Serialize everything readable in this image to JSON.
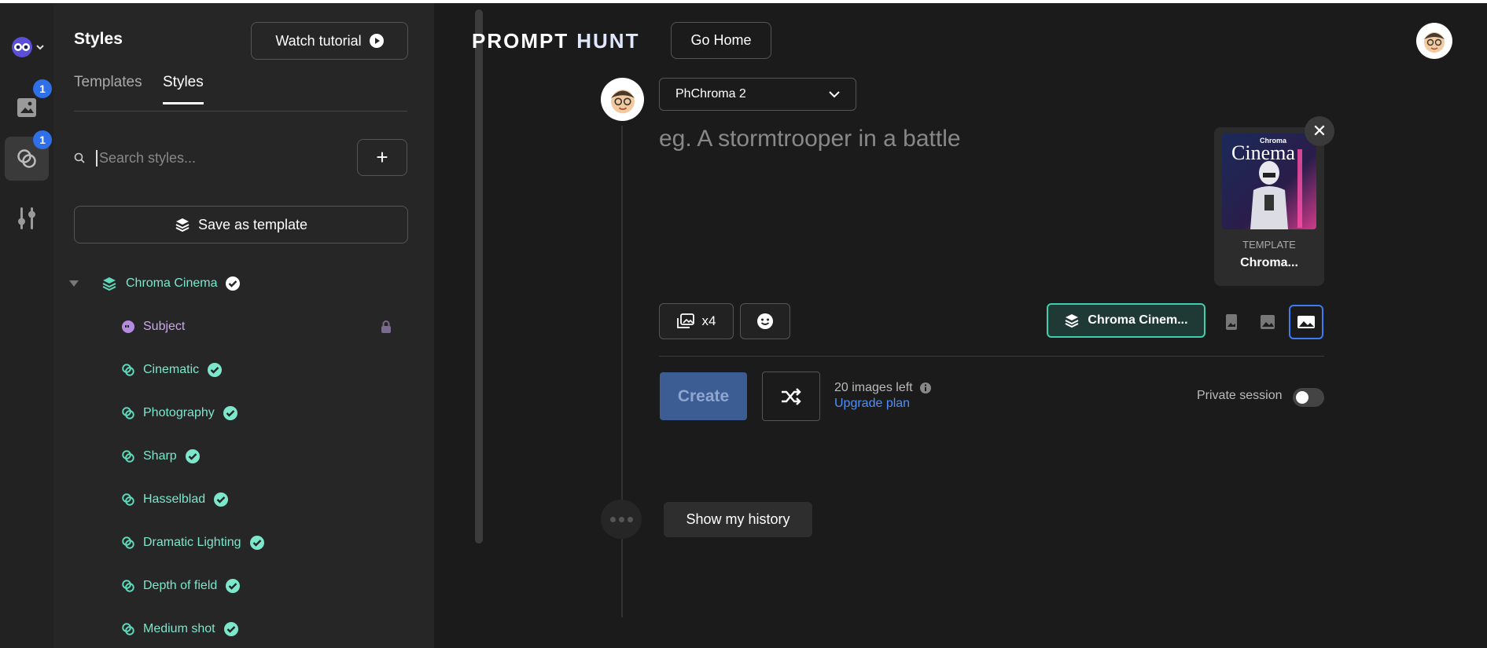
{
  "sidebar": {
    "title": "Styles",
    "watch_tutorial_label": "Watch tutorial",
    "tabs": [
      {
        "label": "Templates"
      },
      {
        "label": "Styles"
      }
    ],
    "search_placeholder": "Search styles...",
    "save_template_label": "Save as template",
    "tree": {
      "root": "Chroma Cinema",
      "items": [
        {
          "label": "Subject",
          "locked": true
        },
        {
          "label": "Cinematic"
        },
        {
          "label": "Photography"
        },
        {
          "label": "Sharp"
        },
        {
          "label": "Hasselblad"
        },
        {
          "label": "Dramatic Lighting"
        },
        {
          "label": "Depth of field"
        },
        {
          "label": "Medium shot"
        }
      ]
    }
  },
  "rail": {
    "images_badge": "1",
    "styles_badge": "1"
  },
  "header": {
    "logo_left": "PROMPT",
    "logo_right": "HUNT",
    "go_home_label": "Go Home"
  },
  "composer": {
    "model": "PhChroma 2",
    "prompt_placeholder": "eg. A stormtrooper in a battle",
    "template_kicker": "TEMPLATE",
    "template_name": "Chroma...",
    "template_image_text_small": "Chroma",
    "template_image_text_big": "Cinema",
    "image_count_label": "x4",
    "style_chip_label": "Chroma Cinem...",
    "create_label": "Create",
    "images_left": "20 images left",
    "upgrade_label": "Upgrade plan",
    "private_label": "Private session",
    "history_label": "Show my history"
  },
  "colors": {
    "accent_teal": "#3fcfb0",
    "link_blue": "#4f8ff7",
    "badge_blue": "#2f6fe8"
  }
}
